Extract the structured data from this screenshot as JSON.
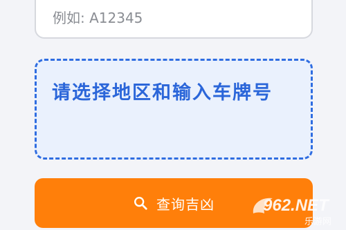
{
  "plate_input": {
    "placeholder": "例如: A12345",
    "value": ""
  },
  "region_selector": {
    "prompt": "请选择地区和输入车牌号"
  },
  "query_button": {
    "label": "查询吉凶",
    "icon": "search-icon"
  },
  "watermark": {
    "logo_text": "962.NET",
    "site_name": "乐游网"
  },
  "colors": {
    "accent_orange": "#ff7f0a",
    "accent_blue": "#2f6de1",
    "panel_blue": "#eaf1fd"
  }
}
